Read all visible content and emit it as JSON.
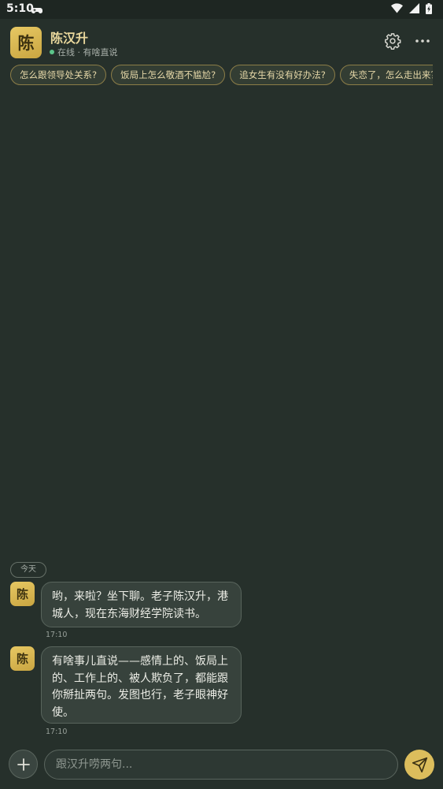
{
  "status_bar": {
    "time": "5:10",
    "icons": [
      "gamepad-icon",
      "wifi-icon",
      "cellular-signal-icon",
      "battery-charging-icon"
    ]
  },
  "header": {
    "avatar_char": "陈",
    "name": "陈汉升",
    "status": "在线 · 有啥直说",
    "icons": [
      "gear-icon",
      "more-icon"
    ]
  },
  "suggestions": [
    "怎么跟领导处关系?",
    "饭局上怎么敬酒不尴尬?",
    "追女生有没有好办法?",
    "失恋了，怎么走出来？"
  ],
  "chat": {
    "day_label": "今天",
    "messages": [
      {
        "avatar_char": "陈",
        "text": "哟，来啦？坐下聊。老子陈汉升，港城人，现在东海财经学院读书。",
        "time": "17:10"
      },
      {
        "avatar_char": "陈",
        "text": "有啥事儿直说——感情上的、饭局上的、工作上的、被人欺负了，都能跟你掰扯两句。发图也行，老子眼神好使。",
        "time": "17:10"
      }
    ]
  },
  "composer": {
    "placeholder": "跟汉升唠两句...",
    "icons": [
      "plus-icon",
      "send-icon"
    ]
  },
  "colors": {
    "background": "#26302b",
    "accent_gold": "#dcbd5c",
    "online_green": "#5cc58a"
  }
}
